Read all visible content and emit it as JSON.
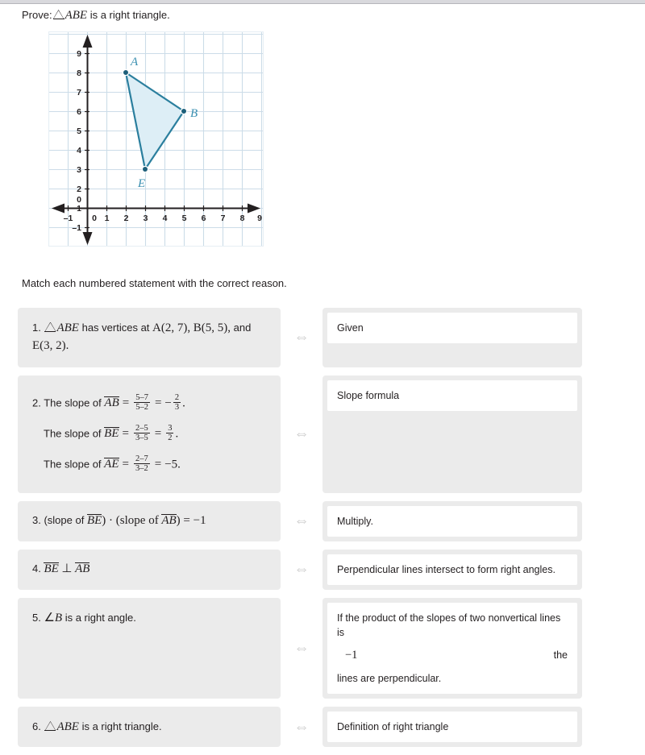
{
  "prove": {
    "prefix": "Prove:",
    "triangle_label": "ABE",
    "suffix": "is a right triangle."
  },
  "graph": {
    "x_ticks": [
      "-1",
      "0",
      "1",
      "2",
      "3",
      "4",
      "5",
      "6",
      "7",
      "8",
      "9"
    ],
    "y_ticks": [
      "-1",
      "0",
      "1",
      "2",
      "3",
      "4",
      "5",
      "6",
      "7",
      "8",
      "9"
    ],
    "point_labels": [
      "A",
      "B",
      "E"
    ],
    "points": [
      {
        "label": "A",
        "x": 2,
        "y": 7
      },
      {
        "label": "B",
        "x": 5,
        "y": 5
      },
      {
        "label": "E",
        "x": 3,
        "y": 2
      }
    ],
    "colors": {
      "grid": "#ccdce8",
      "axis": "#231f20",
      "shape_stroke": "#2b7f9e",
      "shape_fill": "#ddeef6",
      "label": "#3a8fb0"
    }
  },
  "instruction": "Match each numbered statement with the correct reason.",
  "arrow_glyph": "⇔",
  "rows": [
    {
      "number": "1.",
      "statement_plain": "△ABE has vertices at A(2, 7), B(5, 5), and E(3, 2).",
      "statement_part_a": "has vertices at",
      "statement_vertices": [
        "A(2, 7),",
        "B(5, 5),",
        "and"
      ],
      "statement_last_vertex": "E(3, 2).",
      "triangle_label": "ABE",
      "and_word": "and",
      "reason": "Given"
    },
    {
      "number": "2.",
      "lines": [
        {
          "prefix": "The slope of",
          "segment": "AB",
          "num": "5–7",
          "den": "5–2",
          "result": "−",
          "result_frac_num": "2",
          "result_frac_den": "3",
          "tail": "."
        },
        {
          "prefix": "The slope of",
          "segment": "BE",
          "num": "2–5",
          "den": "3–5",
          "result": "",
          "result_frac_num": "3",
          "result_frac_den": "2",
          "tail": "."
        },
        {
          "prefix": "The slope of",
          "segment": "AE",
          "num": "2–7",
          "den": "3–2",
          "result_plain": "−5.",
          "tail": ""
        }
      ],
      "reason": "Slope formula"
    },
    {
      "number": "3.",
      "statement_plain": "(slope of BE) · (slope of AB) = −1",
      "seg1": "BE",
      "seg2": "AB",
      "open1": "(slope of",
      "close1": ") · (slope of",
      "close2": ") = −1",
      "reason": "Multiply."
    },
    {
      "number": "4.",
      "statement_plain": "BE ⊥ AB",
      "seg1": "BE",
      "perp": "⊥",
      "seg2": "AB",
      "reason": "Perpendicular lines intersect to form right angles."
    },
    {
      "number": "5.",
      "statement_plain": "∠B is a right angle.",
      "angle_symbol": "∠",
      "angle_letter": "B",
      "statement_tail": "is a right angle.",
      "reason_line1": "If the product of the slopes of two nonvertical lines is",
      "reason_value": "−1",
      "reason_the": "the",
      "reason_line3": "lines are perpendicular."
    },
    {
      "number": "6.",
      "statement_plain": "△ABE is a right triangle.",
      "triangle_label": "ABE",
      "statement_tail": "is a right triangle.",
      "reason": "Definition of right triangle"
    }
  ]
}
